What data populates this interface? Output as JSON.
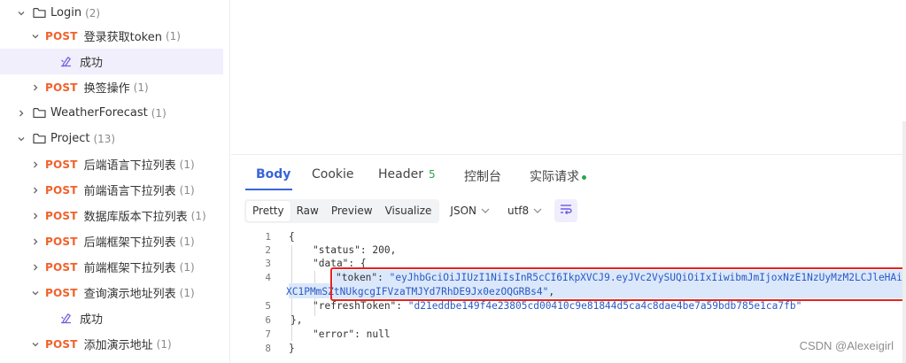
{
  "sidebar": {
    "rows": [
      {
        "type": "folder",
        "label": "Login",
        "count": "(2)",
        "expanded": true,
        "indent": 0
      },
      {
        "type": "api",
        "method": "POST",
        "label": "登录获取token",
        "count": "(1)",
        "expanded": true,
        "indent": 1
      },
      {
        "type": "example",
        "label": "成功",
        "indent": 2,
        "selected": true
      },
      {
        "type": "api",
        "method": "POST",
        "label": "换签操作",
        "count": "(1)",
        "expanded": false,
        "indent": 1
      },
      {
        "type": "folder",
        "label": "WeatherForecast",
        "count": "(1)",
        "expanded": false,
        "indent": 0
      },
      {
        "type": "folder",
        "label": "Project",
        "count": "(13)",
        "expanded": true,
        "indent": 0
      },
      {
        "type": "api",
        "method": "POST",
        "label": "后端语言下拉列表",
        "count": "(1)",
        "expanded": false,
        "indent": 1
      },
      {
        "type": "api",
        "method": "POST",
        "label": "前端语言下拉列表",
        "count": "(1)",
        "expanded": false,
        "indent": 1
      },
      {
        "type": "api",
        "method": "POST",
        "label": "数据库版本下拉列表",
        "count": "(1)",
        "expanded": false,
        "indent": 1
      },
      {
        "type": "api",
        "method": "POST",
        "label": "后端框架下拉列表",
        "count": "(1)",
        "expanded": false,
        "indent": 1
      },
      {
        "type": "api",
        "method": "POST",
        "label": "前端框架下拉列表",
        "count": "(1)",
        "expanded": false,
        "indent": 1
      },
      {
        "type": "api",
        "method": "POST",
        "label": "查询演示地址列表",
        "count": "(1)",
        "expanded": true,
        "indent": 1
      },
      {
        "type": "example",
        "label": "成功",
        "indent": 2,
        "selected": false
      },
      {
        "type": "api",
        "method": "POST",
        "label": "添加演示地址",
        "count": "(1)",
        "expanded": true,
        "indent": 1
      }
    ]
  },
  "response": {
    "tabs": {
      "body": "Body",
      "cookie": "Cookie",
      "header": "Header",
      "header_count": "5",
      "console": "控制台",
      "actual_request": "实际请求"
    },
    "toolbar": {
      "pretty": "Pretty",
      "raw": "Raw",
      "preview": "Preview",
      "visualize": "Visualize",
      "format": "JSON",
      "encoding": "utf8"
    },
    "code": {
      "line_numbers": [
        "1",
        "2",
        "3",
        "4",
        "",
        "5",
        "6",
        "7",
        "8"
      ],
      "l1": "{",
      "l2_key": "\"status\"",
      "l2_val": "200",
      "l3_key": "\"data\"",
      "l3_rest": ": {",
      "l4_key": "\"token\"",
      "l4_val": "\"eyJhbGciOiJIUzI1NiIsInR5cCI6IkpXVCJ9.eyJVc2VySUQiOiIxIiwibmJmIjoxNzE1NzUyMzM2LCJleHAiOjE",
      "l4b_val": "XC1PMmSZtNUkgcgIFVzaTMJYd7RhDE9Jx0ezOQGRBs4\"",
      "l5_key": "\"refreshToken\"",
      "l5_val": "\"d21eddbe149f4e23805cd00410c9e81844d5ca4c8dae4be7a59bdb785e1ca7fb\"",
      "l6": "},",
      "l7_key": "\"error\"",
      "l7_val": "null",
      "l8": "}"
    }
  },
  "watermark": "CSDN @Alexeigirl",
  "colors": {
    "accent": "#3a64d8",
    "method_post": "#f1612a",
    "success_green": "#2ca64a",
    "highlight_box": "#e6231f"
  }
}
